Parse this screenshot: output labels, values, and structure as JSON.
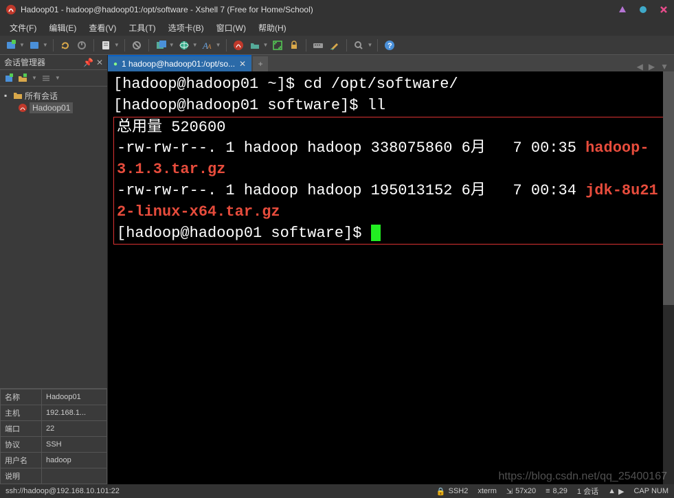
{
  "window": {
    "title": "Hadoop01 - hadoop@hadoop01:/opt/software - Xshell 7 (Free for Home/School)"
  },
  "menu": {
    "file": "文件(F)",
    "edit": "编辑(E)",
    "view": "查看(V)",
    "tools": "工具(T)",
    "tabs": "选项卡(B)",
    "window": "窗口(W)",
    "help": "帮助(H)"
  },
  "sidebar": {
    "title": "会话管理器",
    "tree": {
      "root": "所有会话",
      "child": "Hadoop01"
    },
    "props": {
      "name_label": "名称",
      "name_val": "Hadoop01",
      "host_label": "主机",
      "host_val": "192.168.1...",
      "port_label": "端口",
      "port_val": "22",
      "proto_label": "协议",
      "proto_val": "SSH",
      "user_label": "用户名",
      "user_val": "hadoop",
      "desc_label": "说明",
      "desc_val": ""
    }
  },
  "tab": {
    "label": "1 hadoop@hadoop01:/opt/so..."
  },
  "terminal": {
    "line1": "[hadoop@hadoop01 ~]$ cd /opt/software/",
    "line2": "[hadoop@hadoop01 software]$ ll",
    "line3": "总用量 520600",
    "line4a": "-rw-rw-r--. 1 hadoop hadoop 338075860 6月   7 00:35 ",
    "line4b": "hadoop-3.1.3.tar.gz",
    "line5a": "-rw-rw-r--. 1 hadoop hadoop 195013152 6月   7 00:34 ",
    "line5b": "jdk-8u212-linux-x64.tar.gz",
    "line6": "[hadoop@hadoop01 software]$ "
  },
  "status": {
    "conn": "ssh://hadoop@192.168.10.101:22",
    "ssh": "SSH2",
    "term": "xterm",
    "size": "57x20",
    "pos": "8,29",
    "sess": "1 会话",
    "caps": "CAP  NUM"
  },
  "watermark": "https://blog.csdn.net/qq_25400167"
}
